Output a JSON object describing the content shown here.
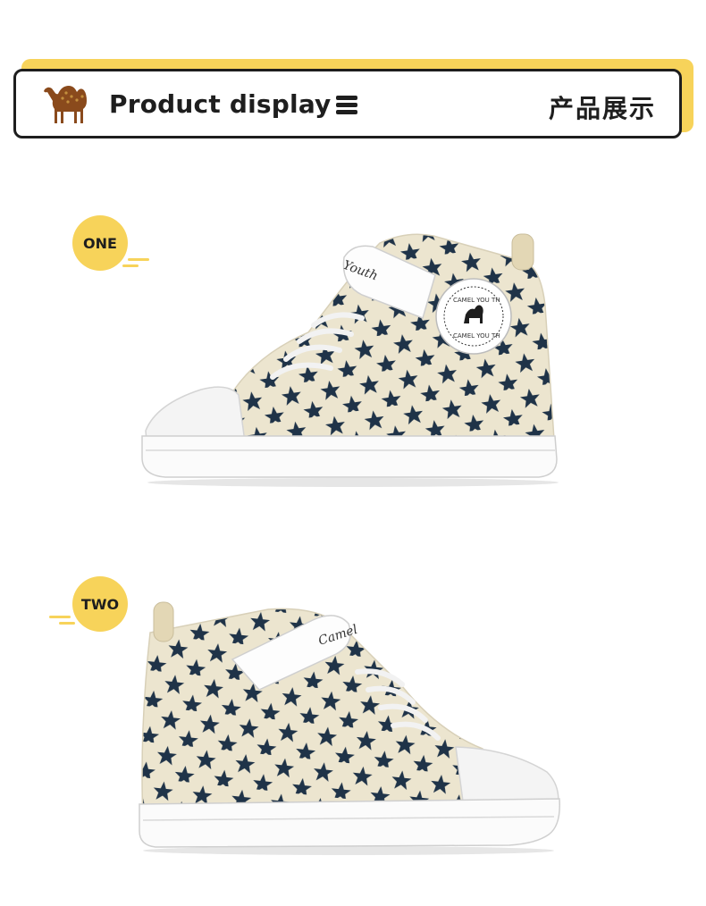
{
  "header": {
    "title_en": "Product display",
    "title_cn": "产品展示",
    "logo_icon": "camel-logo-icon",
    "menu_icon": "menu-icon"
  },
  "sections": [
    {
      "badge": "ONE",
      "image": "high-top-star-sneaker-side-view-right"
    },
    {
      "badge": "TWO",
      "image": "high-top-star-sneaker-side-view-left"
    }
  ],
  "shoe_text": {
    "patch_top": "CAMEL YOU TH",
    "patch_bottom": "CAMEL YOU TH",
    "strap_one": "Youth",
    "strap_two": "Camel"
  },
  "colors": {
    "accent": "#f7d35a",
    "outline": "#1e1e1e",
    "canvas": "#ece5cf",
    "star": "#1f3348",
    "logo": "#8a4a1c"
  }
}
